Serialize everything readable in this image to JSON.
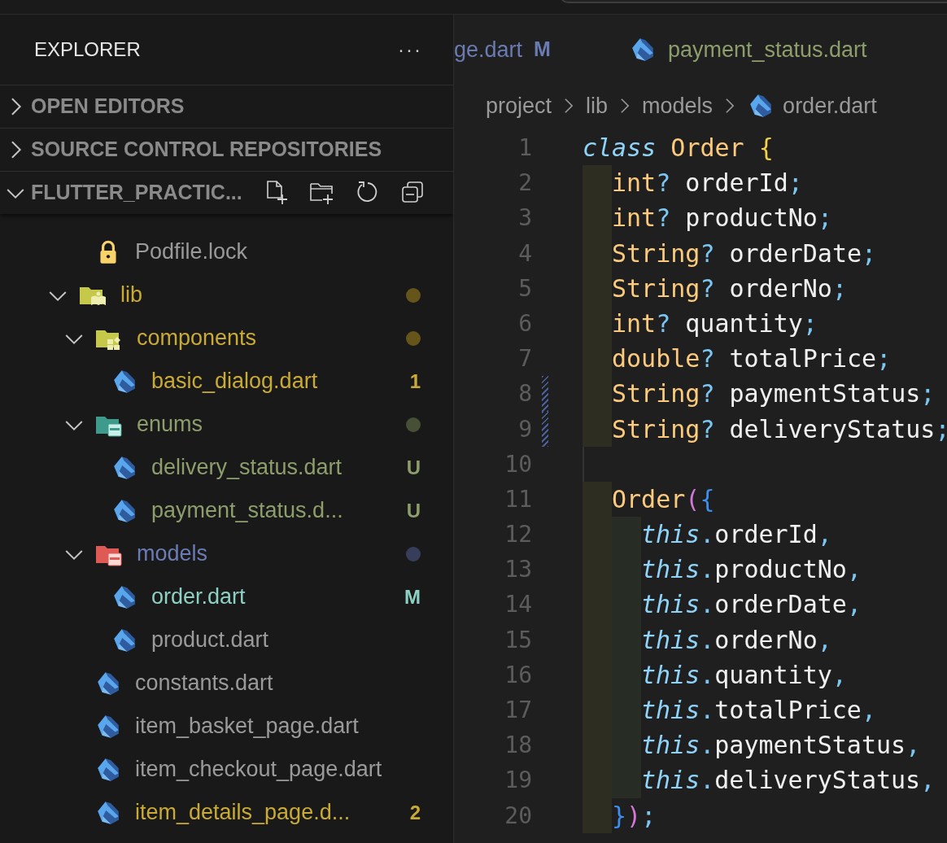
{
  "sidebar": {
    "title": "EXPLORER",
    "more": "···",
    "sections": [
      {
        "label": "OPEN EDITORS",
        "expanded": false
      },
      {
        "label": "SOURCE CONTROL REPOSITORIES",
        "expanded": false
      }
    ],
    "workspace": {
      "label": "FLUTTER_PRACTIC...",
      "expanded": true
    },
    "hidden_parent_items": [
      {
        "name": "Podfile.lock",
        "kind": "lock",
        "color": "#9a9a9a"
      }
    ],
    "tree": [
      {
        "name": "lib",
        "kind": "folder-lib",
        "color": "#c9aa35",
        "expanded": true,
        "children": [
          {
            "name": "components",
            "kind": "folder-components",
            "color": "#c9aa35",
            "expanded": true,
            "children": [
              {
                "name": "basic_dialog.dart",
                "kind": "dart",
                "color": "#c9aa35",
                "badge": "1"
              }
            ]
          },
          {
            "name": "enums",
            "kind": "folder-enums",
            "color": "#8d9d6b",
            "expanded": true,
            "children": [
              {
                "name": "delivery_status.dart",
                "kind": "dart",
                "color": "#8d9d6b",
                "badge": "U"
              },
              {
                "name": "payment_status.d...",
                "kind": "dart",
                "color": "#8d9d6b",
                "badge": "U"
              }
            ]
          },
          {
            "name": "models",
            "kind": "folder-models",
            "color": "#6b7cb5",
            "expanded": true,
            "children": [
              {
                "name": "order.dart",
                "kind": "dart",
                "color": "#8ed0c3",
                "badge": "M"
              },
              {
                "name": "product.dart",
                "kind": "dart",
                "color": "#9a9a9a"
              }
            ]
          },
          {
            "name": "constants.dart",
            "kind": "dart",
            "color": "#9a9a9a"
          },
          {
            "name": "item_basket_page.dart",
            "kind": "dart",
            "color": "#9a9a9a"
          },
          {
            "name": "item_checkout_page.dart",
            "kind": "dart",
            "color": "#9a9a9a"
          },
          {
            "name": "item_details_page.d...",
            "kind": "dart",
            "color": "#c9aa35",
            "badge": "2"
          }
        ]
      }
    ]
  },
  "tabs": [
    {
      "label": "ge.dart",
      "badge": "M",
      "icon": false,
      "selected": false
    },
    {
      "label": "payment_status.dart",
      "icon": true,
      "selected": false
    }
  ],
  "breadcrumb": [
    "project",
    "lib",
    "models",
    "order.dart"
  ],
  "code": [
    {
      "number": "1",
      "changed": false,
      "tokens": [
        {
          "kind": "keyword",
          "text": "class"
        },
        {
          "kind": "type",
          "text": " Order"
        },
        {
          "kind": "brace-gold",
          "text": " {"
        }
      ],
      "children": [
        {
          "number": "2",
          "changed": false,
          "tokens": [
            {
              "kind": "type",
              "text": "int"
            },
            {
              "kind": "punct",
              "text": "?"
            },
            {
              "kind": "ident",
              "text": " orderId"
            },
            {
              "kind": "punct",
              "text": ";"
            }
          ]
        },
        {
          "number": "3",
          "changed": false,
          "tokens": [
            {
              "kind": "type",
              "text": "int"
            },
            {
              "kind": "punct",
              "text": "?"
            },
            {
              "kind": "ident",
              "text": " productNo"
            },
            {
              "kind": "punct",
              "text": ";"
            }
          ]
        },
        {
          "number": "4",
          "changed": false,
          "tokens": [
            {
              "kind": "type",
              "text": "String"
            },
            {
              "kind": "punct",
              "text": "?"
            },
            {
              "kind": "ident",
              "text": " orderDate"
            },
            {
              "kind": "punct",
              "text": ";"
            }
          ]
        },
        {
          "number": "5",
          "changed": false,
          "tokens": [
            {
              "kind": "type",
              "text": "String"
            },
            {
              "kind": "punct",
              "text": "?"
            },
            {
              "kind": "ident",
              "text": " orderNo"
            },
            {
              "kind": "punct",
              "text": ";"
            }
          ]
        },
        {
          "number": "6",
          "changed": false,
          "tokens": [
            {
              "kind": "type",
              "text": "int"
            },
            {
              "kind": "punct",
              "text": "?"
            },
            {
              "kind": "ident",
              "text": " quantity"
            },
            {
              "kind": "punct",
              "text": ";"
            }
          ]
        },
        {
          "number": "7",
          "changed": false,
          "tokens": [
            {
              "kind": "type",
              "text": "double"
            },
            {
              "kind": "punct",
              "text": "?"
            },
            {
              "kind": "ident",
              "text": " totalPrice"
            },
            {
              "kind": "punct",
              "text": ";"
            }
          ]
        },
        {
          "number": "8",
          "changed": true,
          "tokens": [
            {
              "kind": "type",
              "text": "String"
            },
            {
              "kind": "punct",
              "text": "?"
            },
            {
              "kind": "ident",
              "text": " paymentStatus"
            },
            {
              "kind": "punct",
              "text": ";"
            }
          ]
        },
        {
          "number": "9",
          "changed": true,
          "tokens": [
            {
              "kind": "type",
              "text": "String"
            },
            {
              "kind": "punct",
              "text": "?"
            },
            {
              "kind": "ident",
              "text": " deliveryStatus"
            },
            {
              "kind": "punct",
              "text": ";"
            }
          ]
        },
        {
          "number": "10",
          "changed": false
        },
        {
          "number": "11",
          "changed": false,
          "tokens": [
            {
              "kind": "type",
              "text": "Order"
            },
            {
              "kind": "paren",
              "text": "("
            },
            {
              "kind": "brace-blue",
              "text": "{"
            }
          ],
          "children": [
            {
              "number": "12",
              "changed": false,
              "tokens": [
                {
                  "kind": "keyword",
                  "text": "this"
                },
                {
                  "kind": "punct",
                  "text": "."
                },
                {
                  "kind": "ident",
                  "text": "orderId"
                },
                {
                  "kind": "punct",
                  "text": ","
                }
              ]
            },
            {
              "number": "13",
              "changed": false,
              "tokens": [
                {
                  "kind": "keyword",
                  "text": "this"
                },
                {
                  "kind": "punct",
                  "text": "."
                },
                {
                  "kind": "ident",
                  "text": "productNo"
                },
                {
                  "kind": "punct",
                  "text": ","
                }
              ]
            },
            {
              "number": "14",
              "changed": false,
              "tokens": [
                {
                  "kind": "keyword",
                  "text": "this"
                },
                {
                  "kind": "punct",
                  "text": "."
                },
                {
                  "kind": "ident",
                  "text": "orderDate"
                },
                {
                  "kind": "punct",
                  "text": ","
                }
              ]
            },
            {
              "number": "15",
              "changed": false,
              "tokens": [
                {
                  "kind": "keyword",
                  "text": "this"
                },
                {
                  "kind": "punct",
                  "text": "."
                },
                {
                  "kind": "ident",
                  "text": "orderNo"
                },
                {
                  "kind": "punct",
                  "text": ","
                }
              ]
            },
            {
              "number": "16",
              "changed": false,
              "tokens": [
                {
                  "kind": "keyword",
                  "text": "this"
                },
                {
                  "kind": "punct",
                  "text": "."
                },
                {
                  "kind": "ident",
                  "text": "quantity"
                },
                {
                  "kind": "punct",
                  "text": ","
                }
              ]
            },
            {
              "number": "17",
              "changed": false,
              "tokens": [
                {
                  "kind": "keyword",
                  "text": "this"
                },
                {
                  "kind": "punct",
                  "text": "."
                },
                {
                  "kind": "ident",
                  "text": "totalPrice"
                },
                {
                  "kind": "punct",
                  "text": ","
                }
              ]
            },
            {
              "number": "18",
              "changed": false,
              "tokens": [
                {
                  "kind": "keyword",
                  "text": "this"
                },
                {
                  "kind": "punct",
                  "text": "."
                },
                {
                  "kind": "ident",
                  "text": "paymentStatus"
                },
                {
                  "kind": "punct",
                  "text": ","
                }
              ]
            },
            {
              "number": "19",
              "changed": false,
              "tokens": [
                {
                  "kind": "keyword",
                  "text": "this"
                },
                {
                  "kind": "punct",
                  "text": "."
                },
                {
                  "kind": "ident",
                  "text": "deliveryStatus"
                },
                {
                  "kind": "punct",
                  "text": ","
                }
              ]
            }
          ]
        },
        {
          "number": "20",
          "changed": false,
          "tokens": [
            {
              "kind": "brace-blue",
              "text": "}"
            },
            {
              "kind": "paren",
              "text": ")"
            },
            {
              "kind": "punct",
              "text": ";"
            }
          ]
        }
      ]
    }
  ]
}
